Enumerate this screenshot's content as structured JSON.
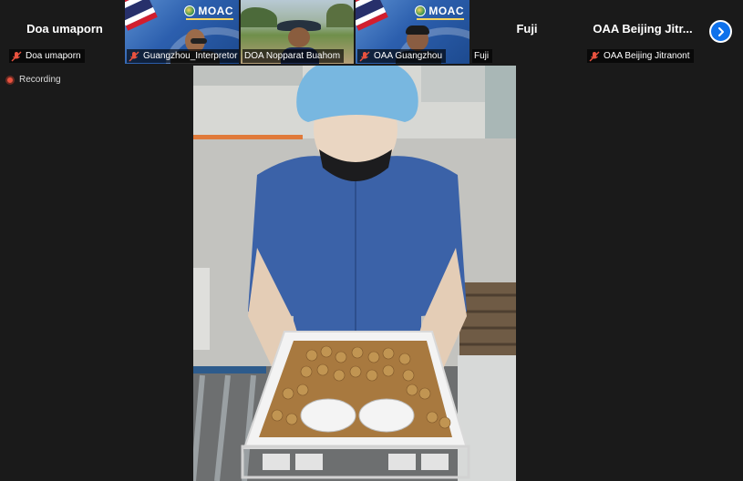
{
  "participants": [
    {
      "name": "Doa umaporn",
      "label": "Doa umaporn",
      "video": false,
      "muted": true
    },
    {
      "name": "Guangzhou_Interpretor",
      "label": "Guangzhou_Interpretor",
      "video": true,
      "muted": true
    },
    {
      "name": "DOA Nopparat Buahom",
      "label": "DOA Nopparat Buahom",
      "video": true,
      "muted": false
    },
    {
      "name": "OAA Guangzhou",
      "label": "OAA Guangzhou",
      "video": true,
      "muted": true
    },
    {
      "name": "Fuji",
      "label": "Fuji",
      "video": false,
      "muted": false
    },
    {
      "name": "OAA Beijing Jitr...",
      "label": "OAA Beijing Jitranont",
      "video": false,
      "muted": true
    }
  ],
  "moac_logo_text": "MOAC",
  "recording_label": "Recording",
  "icons": {
    "next": "chevron-right-icon",
    "mic_off": "microphone-off-icon",
    "recording": "recording-dot-icon"
  },
  "colors": {
    "accent": "#0e71eb",
    "mic_off": "#e8523f",
    "recording": "#e8523f",
    "background": "#1a1a1a"
  }
}
